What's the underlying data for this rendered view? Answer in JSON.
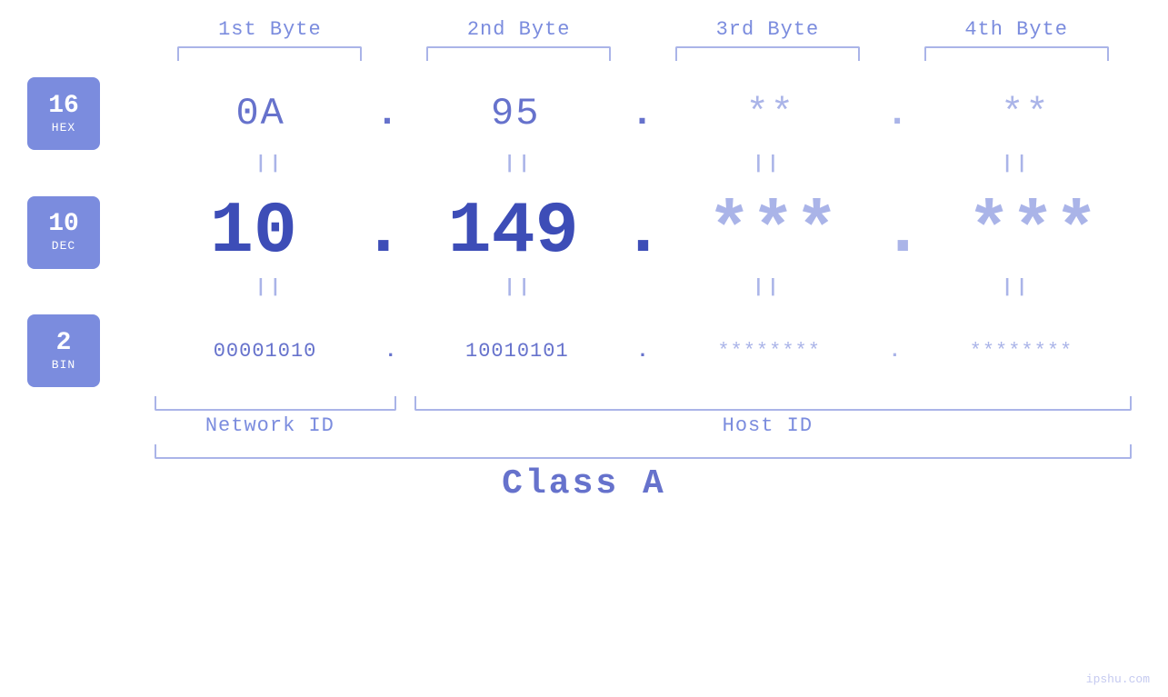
{
  "header": {
    "byte1_label": "1st Byte",
    "byte2_label": "2nd Byte",
    "byte3_label": "3rd Byte",
    "byte4_label": "4th Byte"
  },
  "bases": [
    {
      "number": "16",
      "name": "HEX"
    },
    {
      "number": "10",
      "name": "DEC"
    },
    {
      "number": "2",
      "name": "BIN"
    }
  ],
  "hex_values": [
    "0A",
    "95",
    "**",
    "**"
  ],
  "dec_values": [
    "10",
    "149",
    "***",
    "***"
  ],
  "bin_values": [
    "00001010",
    "10010101",
    "********",
    "********"
  ],
  "dots": [
    ".",
    ".",
    ".",
    ""
  ],
  "network_id_label": "Network ID",
  "host_id_label": "Host ID",
  "class_label": "Class A",
  "watermark": "ipshu.com",
  "equals_symbol": "||",
  "colors": {
    "accent": "#6672cc",
    "light": "#aab4e8",
    "base_bg": "#7b8cde",
    "dec_color": "#3d4db7"
  }
}
